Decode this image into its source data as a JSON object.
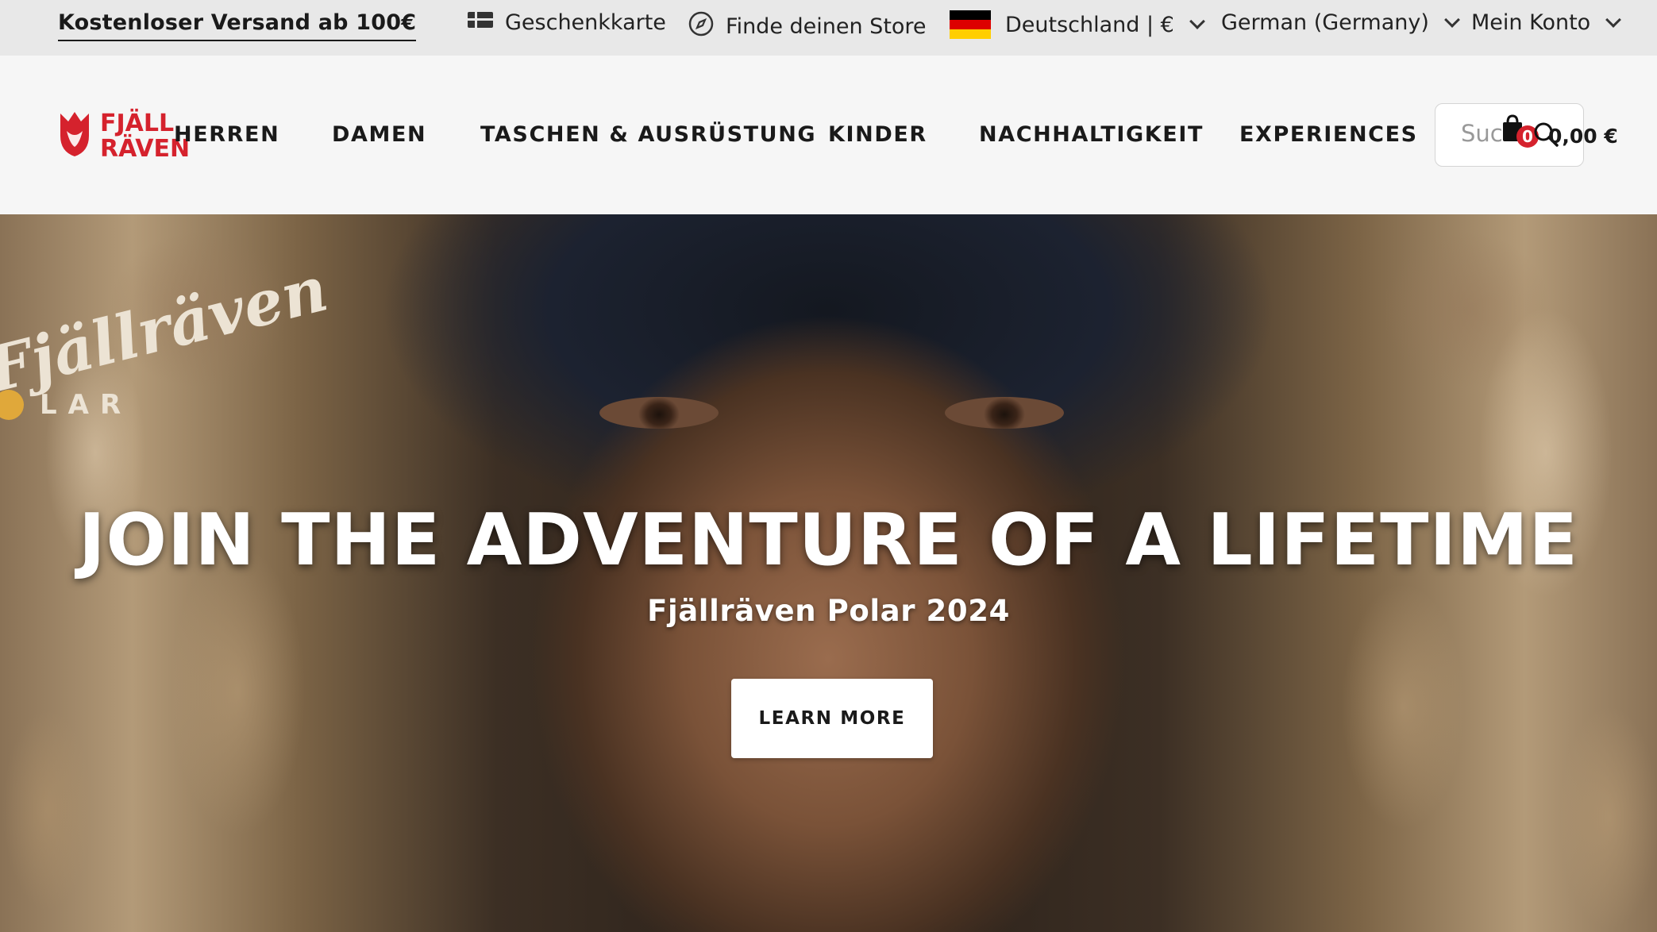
{
  "utility": {
    "promo": "Kostenloser Versand ab 100€",
    "gift_card": "Geschenkkarte",
    "store_finder": "Finde deinen Store",
    "country": "Deutschland | €",
    "language": "German (Germany)",
    "account": "Mein Konto",
    "icons": {
      "gift_card": "gift-card-icon",
      "store_finder": "compass-icon",
      "country": "germany-flag-icon",
      "dropdown": "chevron-down-icon"
    }
  },
  "brand": {
    "logo_line1": "FJÄLL",
    "logo_line2": "RÄVEN",
    "logo_color": "#d5222d"
  },
  "nav": {
    "items": [
      "HERREN",
      "DAMEN",
      "TASCHEN & AUSRÜSTUNG",
      "KINDER",
      "NACHHALTIGKEIT",
      "EXPERIENCES"
    ]
  },
  "search": {
    "placeholder": "Suche"
  },
  "cart": {
    "count": "0",
    "total": "0,00 €",
    "icon": "shopping-bag-icon",
    "search_icon": "search-icon"
  },
  "hero": {
    "brand_script": "Fjällräven",
    "brand_sub": "LAR",
    "title": "JOIN THE ADVENTURE OF A LIFETIME",
    "subtitle": "Fjällräven Polar 2024",
    "cta": "LEARN MORE"
  },
  "colors": {
    "utility_bg": "#e8e8e8",
    "nav_bg": "#f6f6f6",
    "accent_red": "#d5222d",
    "german_flag": [
      "#000000",
      "#dd0000",
      "#ffce00"
    ]
  }
}
